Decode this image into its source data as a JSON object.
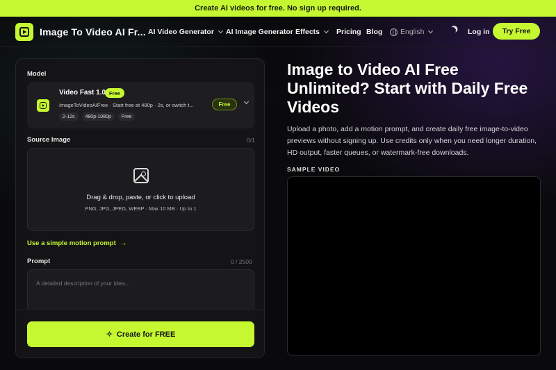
{
  "banner": {
    "text": "Create AI videos for free. No sign up required."
  },
  "nav": {
    "brand": "Image To Video AI Fr...",
    "items": [
      {
        "label": "AI Video Generator"
      },
      {
        "label": "AI Image Generator"
      },
      {
        "label": "Effects"
      },
      {
        "label": "Pricing"
      },
      {
        "label": "Blog"
      }
    ],
    "language": "English",
    "login": "Log in",
    "cta": "Try Free"
  },
  "panel": {
    "model_label": "Model",
    "model": {
      "name": "Video Fast 1.0",
      "badge": "Free",
      "description": "ImageToVideoAIFree · Start free at 480p · 2s, or switch t...",
      "tags": [
        "2-12s",
        "480p-1080p",
        "Free"
      ],
      "price_button": "Free"
    },
    "source_label": "Source Image",
    "source_count": "0/1",
    "upload": {
      "title": "Drag & drop, paste, or click to upload",
      "subtitle": "PNG, JPG, JPEG, WEBP · Max 10 MB · Up to 1"
    },
    "simple_prompt_link": "Use a simple motion prompt",
    "prompt_label": "Prompt",
    "prompt_count": "0 / 2500",
    "prompt_placeholder": "A detailed description of your idea...",
    "create_button": "Create for FREE"
  },
  "hero": {
    "title": "Image to Video AI Free Unlimited? Start with Daily Free Videos",
    "description": "Upload a photo, add a motion prompt, and create daily free image-to-video previews without signing up. Use credits only when you need longer duration, HD output, faster queues, or watermark-free downloads.",
    "sample_label": "SAMPLE VIDEO"
  },
  "colors": {
    "accent": "#c6f832",
    "background": "#0a0a0c",
    "panel": "#141416"
  }
}
